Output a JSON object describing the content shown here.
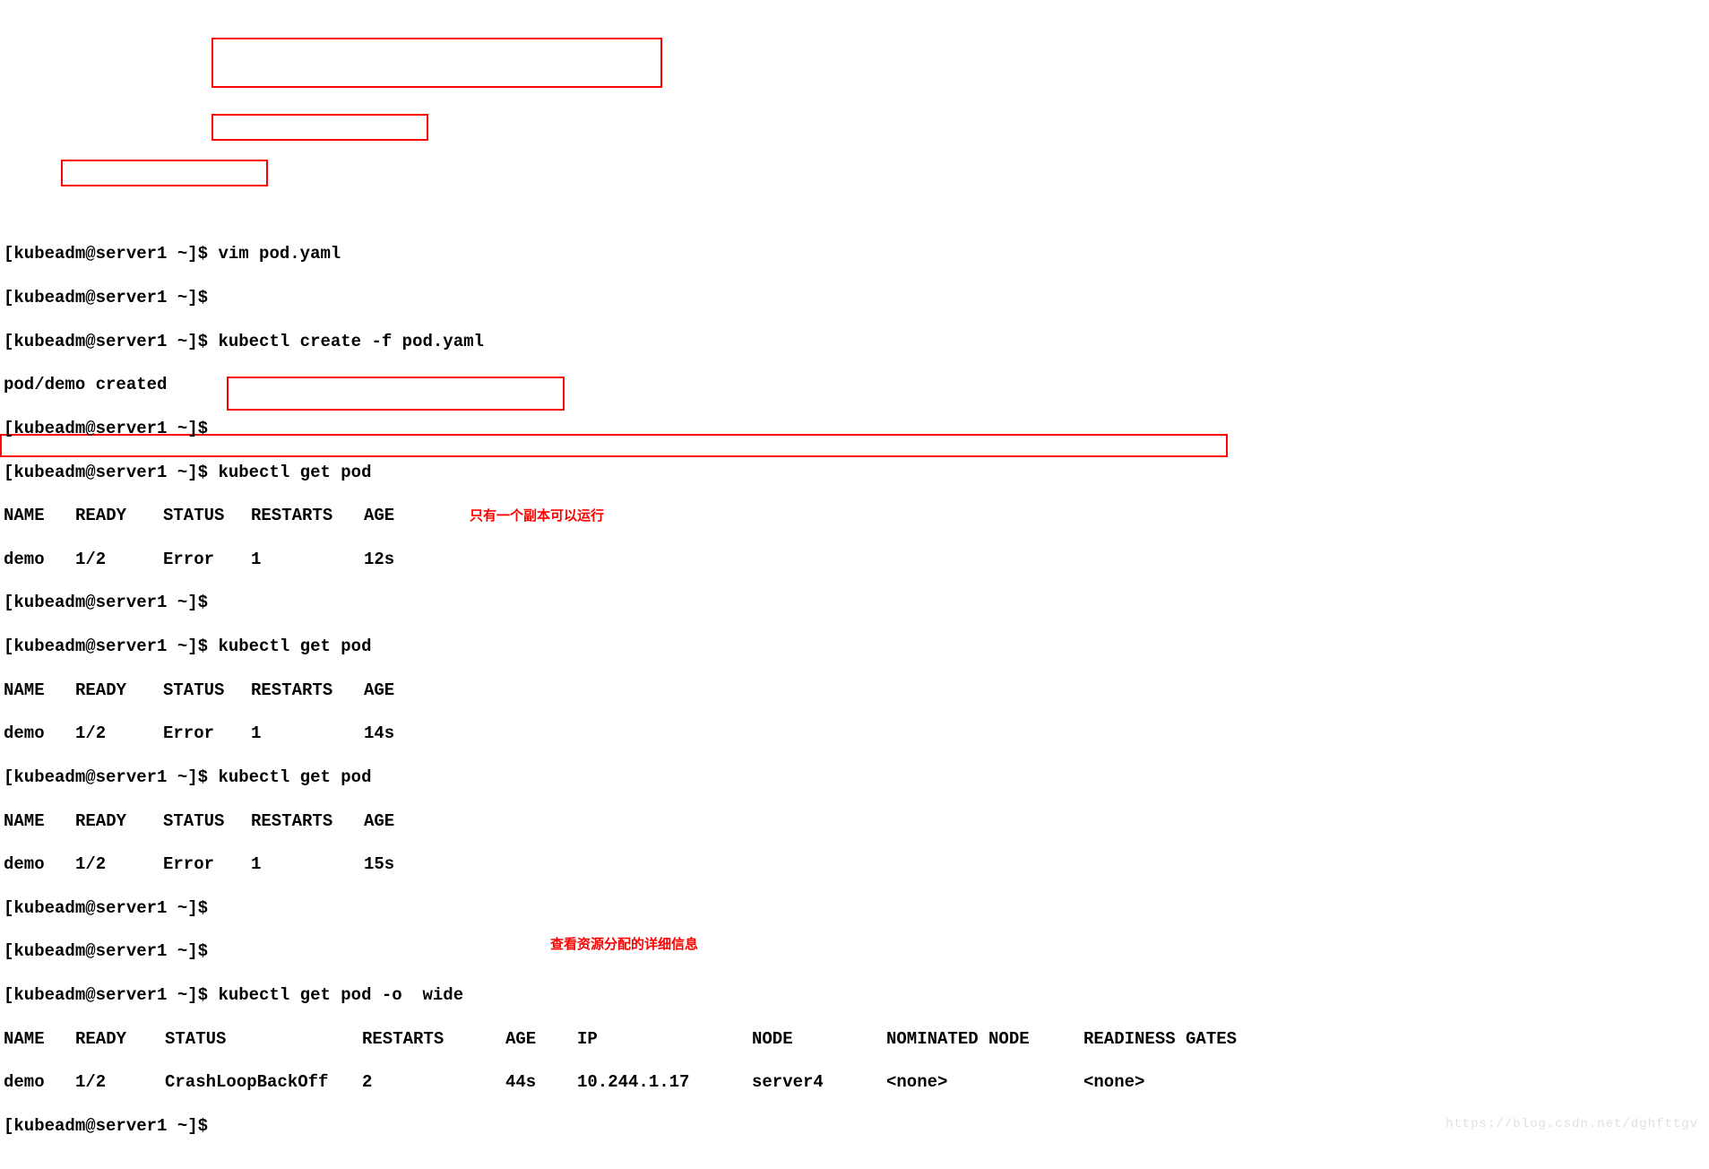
{
  "prompt": "[kubeadm@server1 ~]$ ",
  "cmds": {
    "vim": "vim pod.yaml",
    "create": "kubectl create -f pod.yaml",
    "created": "pod/demo created",
    "get": "kubectl get pod",
    "getwide": "kubectl get pod -o  wide"
  },
  "hdr": {
    "name": "NAME",
    "ready": "READY",
    "status": "STATUS",
    "restarts": "RESTARTS",
    "age": "AGE",
    "ip": "IP",
    "node": "NODE",
    "nom": "NOMINATED NODE",
    "gates": "READINESS GATES"
  },
  "row1": {
    "name": "demo",
    "ready": "1/2",
    "status": "Error",
    "restarts": "1",
    "age": "12s"
  },
  "row2": {
    "name": "demo",
    "ready": "1/2",
    "status": "Error",
    "restarts": "1",
    "age": "14s"
  },
  "row3": {
    "name": "demo",
    "ready": "1/2",
    "status": "Error",
    "restarts": "1",
    "age": "15s"
  },
  "row4": {
    "name": "demo",
    "ready": "1/2",
    "status": "CrashLoopBackOff",
    "restarts": "2",
    "age": "44s",
    "ip": "10.244.1.17",
    "node": "server4",
    "nom": "<none>",
    "gates": "<none>"
  },
  "annot1": "只有一个副本可以运行",
  "annot2": "查看资源分配的详细信息",
  "watermark": "https://blog.csdn.net/dghfttgv"
}
